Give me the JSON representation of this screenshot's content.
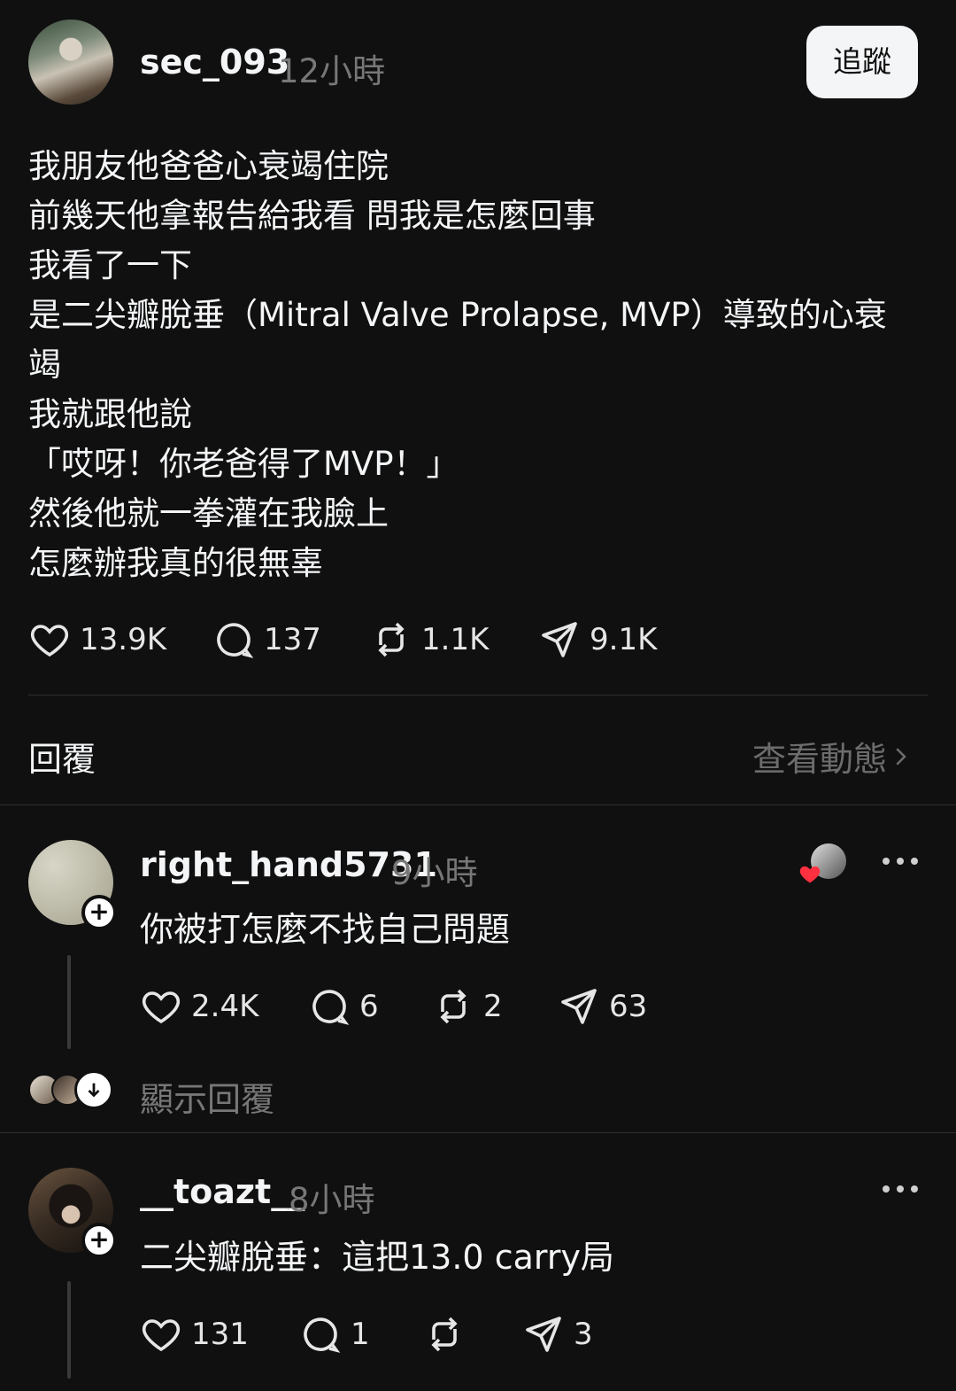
{
  "post": {
    "username": "sec_093",
    "time": "12小時",
    "follow_label": "追蹤",
    "lines": [
      "我朋友他爸爸心衰竭住院",
      "前幾天他拿報告給我看 問我是怎麼回事",
      "我看了一下",
      "是二尖瓣脫垂（Mitral Valve Prolapse, MVP）導致的心衰",
      "竭",
      "我就跟他說",
      "「哎呀！你老爸得了MVP！」",
      "然後他就一拳灌在我臉上",
      "怎麼辦我真的很無辜"
    ],
    "likes": "13.9K",
    "comments": "137",
    "reposts": "1.1K",
    "shares": "9.1K"
  },
  "replies_header": {
    "title": "回覆",
    "view_activity": "查看動態"
  },
  "replies": [
    {
      "username": "right_hand5731",
      "time": "9小時",
      "text": "你被打怎麼不找自己問題",
      "likes": "2.4K",
      "comments": "6",
      "reposts": "2",
      "shares": "63",
      "show_replies": "顯示回覆"
    },
    {
      "username": "__toazt__",
      "time": "8小時",
      "text": "二尖瓣脫垂：這把13.0 carry局",
      "likes": "131",
      "comments": "1",
      "reposts": "",
      "shares": "3"
    }
  ],
  "colors": {
    "background": "#101010",
    "text": "#f3f5f7",
    "muted": "#777777",
    "liked_heart": "#ff3040"
  },
  "icons": [
    "heart-icon",
    "comment-icon",
    "repost-icon",
    "share-icon",
    "more-icon",
    "chevron-right-icon",
    "plus-icon",
    "arrow-down-icon"
  ]
}
